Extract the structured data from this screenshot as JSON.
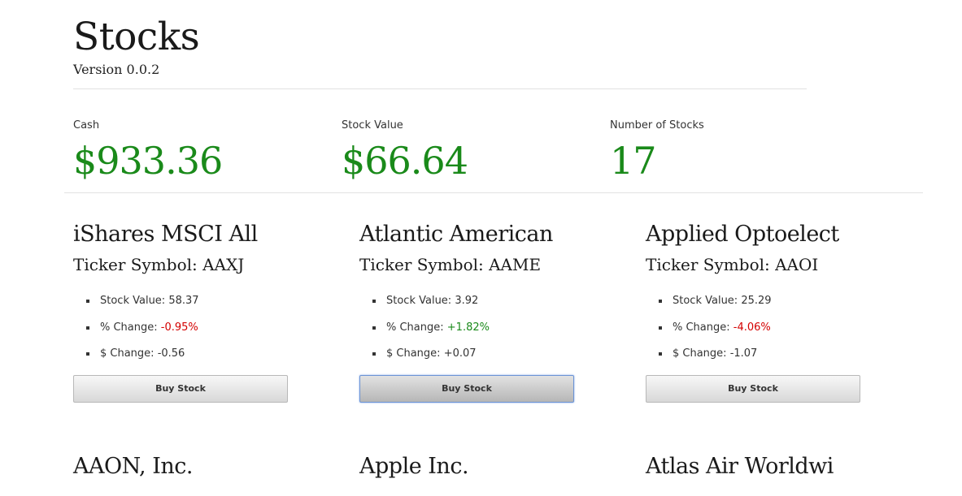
{
  "header": {
    "title": "Stocks",
    "version": "Version 0.0.2"
  },
  "stats": {
    "cash": {
      "label": "Cash",
      "value": "$933.36"
    },
    "stock_value": {
      "label": "Stock Value",
      "value": "$66.64"
    },
    "num_stocks": {
      "label": "Number of Stocks",
      "value": "17"
    }
  },
  "labels": {
    "stock_value": "Stock Value: ",
    "pct_change": "% Change: ",
    "dollar_change": "$ Change: ",
    "buy_button": "Buy Stock"
  },
  "colors": {
    "positive": "#1a8a1a",
    "negative": "#d40000"
  },
  "stocks": [
    {
      "name": "iShares MSCI All",
      "ticker": "Ticker Symbol: AAXJ",
      "stock_value": "58.37",
      "pct_change": "-0.95%",
      "dollar_change": "-0.56"
    },
    {
      "name": "Atlantic American",
      "ticker": "Ticker Symbol: AAME",
      "stock_value": "3.92",
      "pct_change": "+1.82%",
      "dollar_change": "+0.07"
    },
    {
      "name": "Applied Optoelect",
      "ticker": "Ticker Symbol: AAOI",
      "stock_value": "25.29",
      "pct_change": "-4.06%",
      "dollar_change": "-1.07"
    },
    {
      "name": "AAON, Inc."
    },
    {
      "name": "Apple Inc."
    },
    {
      "name": "Atlas Air Worldwi"
    }
  ]
}
